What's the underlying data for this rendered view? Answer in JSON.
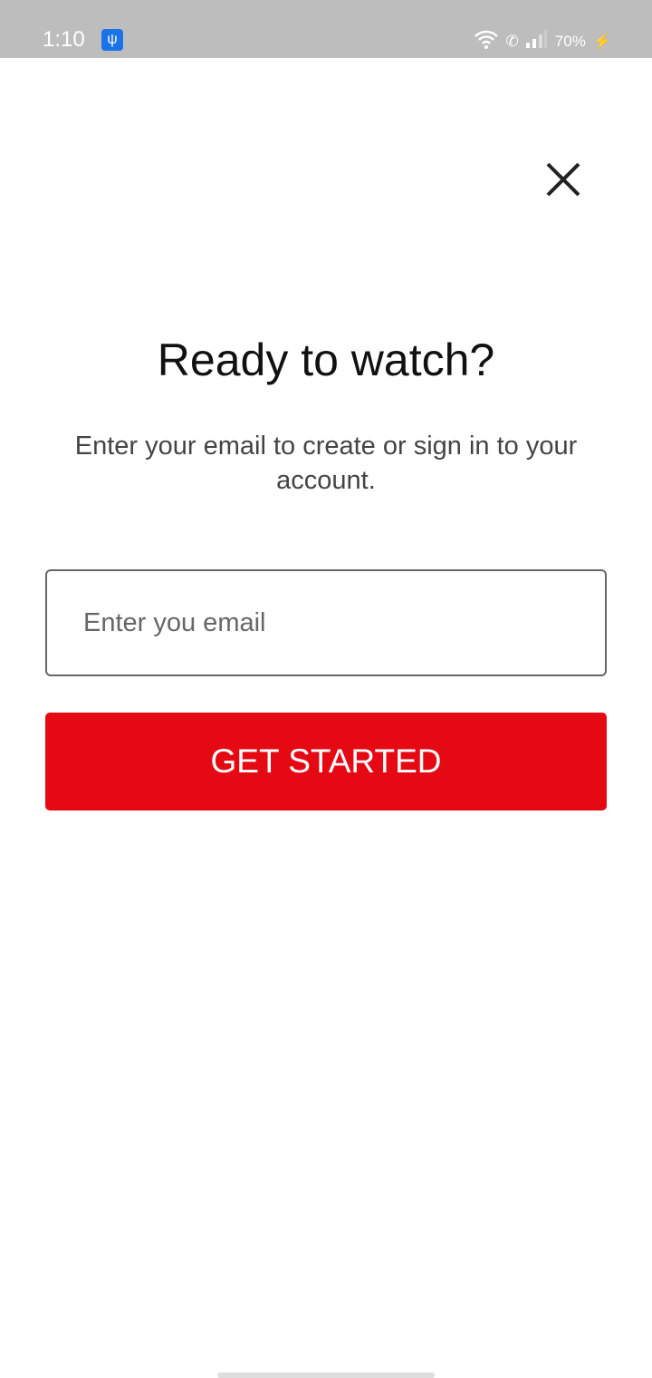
{
  "status": {
    "time": "1:10",
    "battery": "70%"
  },
  "main": {
    "title": "Ready to watch?",
    "subtitle": "Enter your email to create or sign in to your account.",
    "email_placeholder": "Enter you email",
    "button": "GET STARTED"
  },
  "colors": {
    "accent": "#e50914"
  }
}
